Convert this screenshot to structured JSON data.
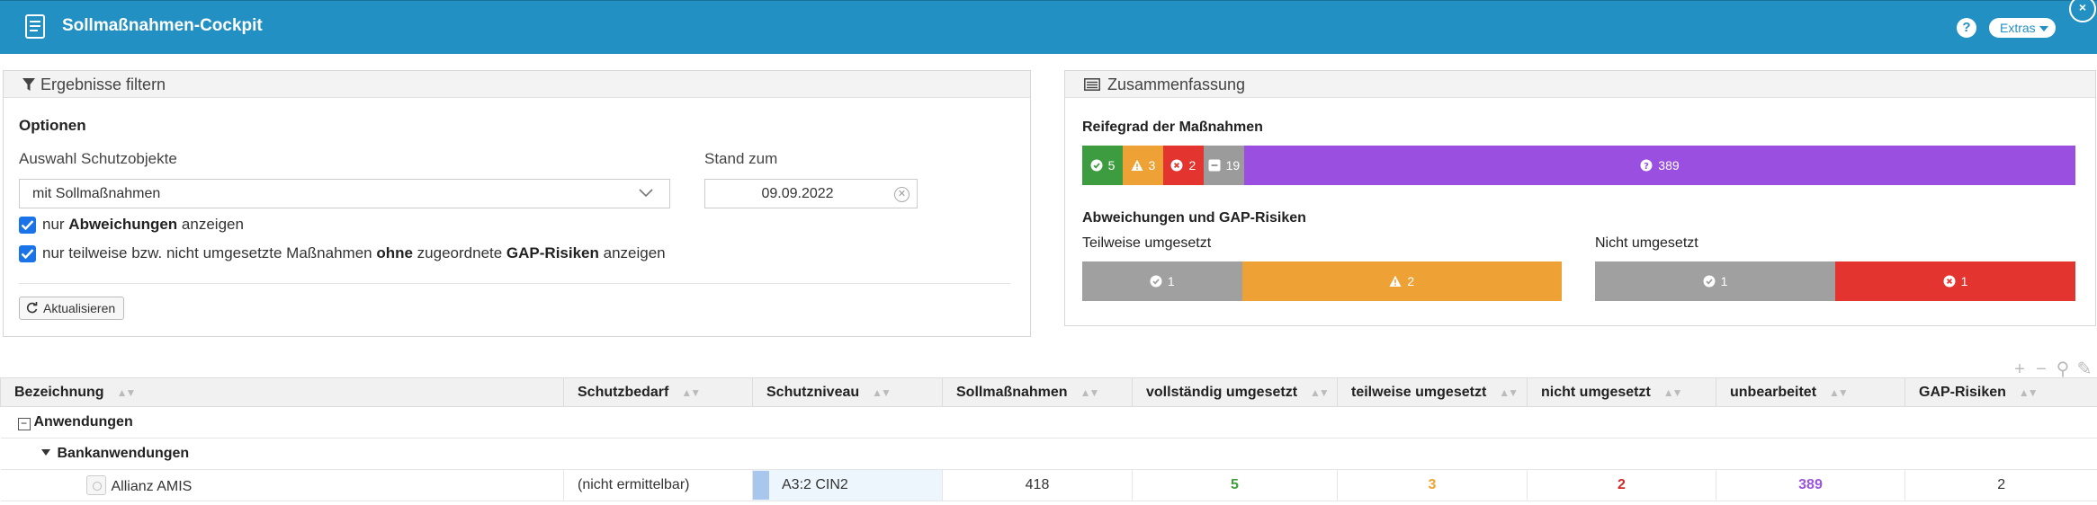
{
  "window": {
    "title": "Sollmaßnahmen-Cockpit",
    "help_label": "?",
    "extras_label": "Extras",
    "close_label": "×"
  },
  "filter": {
    "panel_title": "Ergebnisse filtern",
    "options_title": "Optionen",
    "selection_label": "Auswahl Schutzobjekte",
    "selection_value": "mit Sollmaßnahmen",
    "date_label": "Stand zum",
    "date_value": "09.09.2022",
    "check1": {
      "pre": "nur ",
      "bold": "Abweichungen",
      "post": " anzeigen"
    },
    "check2": {
      "pre": "nur teilweise bzw. nicht umgesetzte Maßnahmen ",
      "bold1": "ohne",
      "mid": " zugeordnete ",
      "bold2": "GAP-Risiken",
      "post": " anzeigen"
    },
    "refresh_label": "Aktualisieren"
  },
  "summary": {
    "panel_title": "Zusammenfassung",
    "maturity_label": "Reifegrad der Maßnahmen",
    "maturity": [
      {
        "icon": "check-circle",
        "value": "5",
        "color": "#3d9c40"
      },
      {
        "icon": "warning",
        "value": "3",
        "color": "#eea236"
      },
      {
        "icon": "x-circle",
        "value": "2",
        "color": "#e3342f"
      },
      {
        "icon": "minus-square",
        "value": "19",
        "color": "#9b9b9b"
      },
      {
        "icon": "question-circle",
        "value": "389",
        "color": "#9a4fe0"
      }
    ],
    "gap_label": "Abweichungen und GAP-Risiken",
    "partial_label": "Teilweise umgesetzt",
    "partial": [
      {
        "icon": "check-circle",
        "value": "1",
        "color": "#a0a0a0"
      },
      {
        "icon": "warning",
        "value": "2",
        "color": "#eea236"
      }
    ],
    "not_label": "Nicht umgesetzt",
    "not": [
      {
        "icon": "check-circle",
        "value": "1",
        "color": "#a0a0a0"
      },
      {
        "icon": "x-circle",
        "value": "1",
        "color": "#e3342f"
      }
    ]
  },
  "table": {
    "columns": [
      "Bezeichnung",
      "Schutzbedarf",
      "Schutzniveau",
      "Sollmaßnahmen",
      "vollständig umgesetzt",
      "teilweise umgesetzt",
      "nicht umgesetzt",
      "unbearbeitet",
      "GAP-Risiken"
    ],
    "group1": "Anwendungen",
    "group2": "Bankanwendungen",
    "row": {
      "name": "Allianz AMIS",
      "schutzbedarf": "(nicht ermittelbar)",
      "schutzniveau": "A3:2 CIN2",
      "soll": "418",
      "voll": "5",
      "teil": "3",
      "nicht": "2",
      "unbearbeitet": "389",
      "gap": "2"
    }
  }
}
